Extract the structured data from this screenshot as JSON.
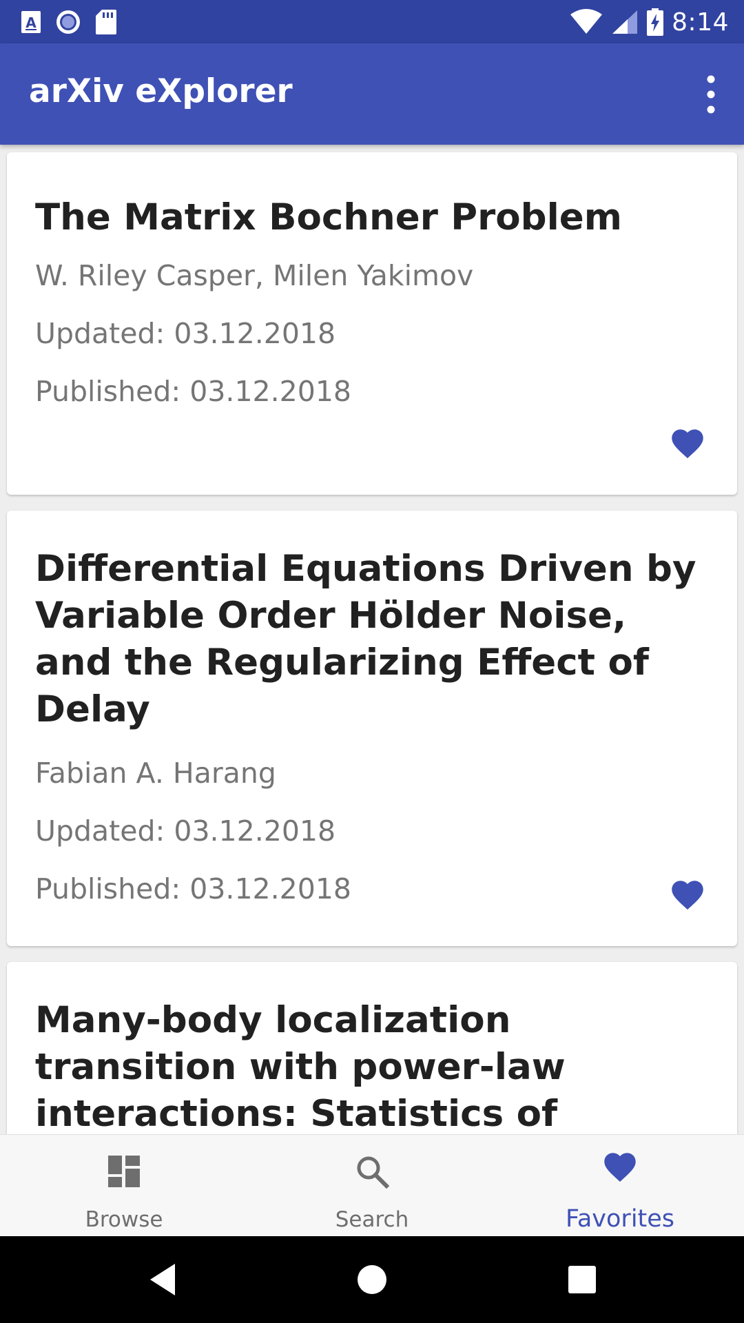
{
  "status_bar": {
    "time": "8:14",
    "left_icons": [
      "font-a-icon",
      "circle-record-icon",
      "sd-card-icon"
    ],
    "right_icons": [
      "wifi-icon",
      "cell-signal-icon",
      "battery-charging-icon"
    ]
  },
  "app_bar": {
    "title": "arXiv eXplorer",
    "menu_icon": "more-vert-icon"
  },
  "papers": [
    {
      "title": "The Matrix Bochner Problem",
      "authors": "W. Riley Casper, Milen Yakimov",
      "updated": "Updated: 03.12.2018",
      "published": "Published: 03.12.2018",
      "favorite": true
    },
    {
      "title": "Differential Equations Driven by Variable Order Hölder Noise, and the Regularizing Effect of Delay",
      "authors": "Fabian A. Harang",
      "updated": "Updated: 03.12.2018",
      "published": "Published: 03.12.2018",
      "favorite": true
    },
    {
      "title": "Many-body localization transition with power-law interactions: Statistics of eigenstates"
    }
  ],
  "bottom_nav": {
    "items": [
      {
        "label": "Browse",
        "icon": "dashboard-icon",
        "active": false
      },
      {
        "label": "Search",
        "icon": "search-icon",
        "active": false
      },
      {
        "label": "Favorites",
        "icon": "heart-icon",
        "active": true
      }
    ]
  },
  "system_nav": {
    "buttons": [
      "back-icon",
      "home-icon",
      "recents-icon"
    ]
  },
  "colors": {
    "primary": "#3f51b5",
    "primary_dark": "#3143a0",
    "text_primary": "#212121",
    "text_secondary": "#757575",
    "nav_inactive": "#6e6e6e"
  }
}
